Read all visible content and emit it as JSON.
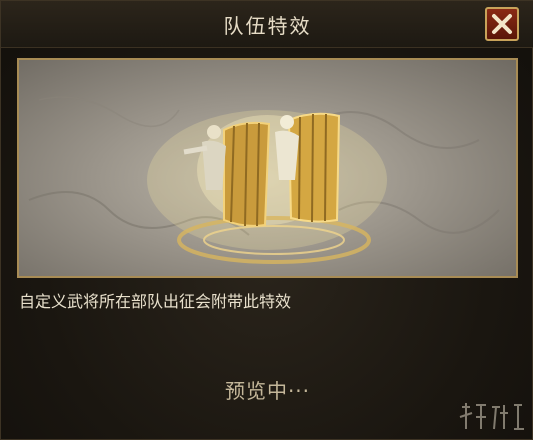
{
  "dialog": {
    "title": "队伍特效",
    "close_icon": "close-x-icon"
  },
  "preview": {
    "image": "two-soldiers-with-shields-golden-effect"
  },
  "description": "自定义武将所在部队出征会附带此特效",
  "status": "预览中···",
  "colors": {
    "accent_gold": "#c8a35a",
    "close_red": "#8a2a14",
    "text_light": "#e8e0cc"
  }
}
